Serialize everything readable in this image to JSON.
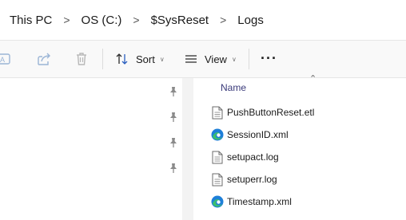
{
  "breadcrumb": {
    "items": [
      "This PC",
      "OS (C:)",
      "$SysReset",
      "Logs"
    ],
    "separator": ">"
  },
  "toolbar": {
    "sort_label": "Sort",
    "view_label": "View",
    "more_label": "···"
  },
  "file_list": {
    "column_header": "Name",
    "files": [
      {
        "name": "PushButtonReset.etl",
        "icon": "document-icon"
      },
      {
        "name": "SessionID.xml",
        "icon": "edge-icon"
      },
      {
        "name": "setupact.log",
        "icon": "document-icon"
      },
      {
        "name": "setuperr.log",
        "icon": "document-icon"
      },
      {
        "name": "Timestamp.xml",
        "icon": "edge-icon"
      }
    ]
  },
  "colors": {
    "toolbar_bg": "#f9f9f9",
    "header_text": "#3a3a7a",
    "edge_blue": "#1e7fd8",
    "edge_green": "#3cbf6d"
  }
}
